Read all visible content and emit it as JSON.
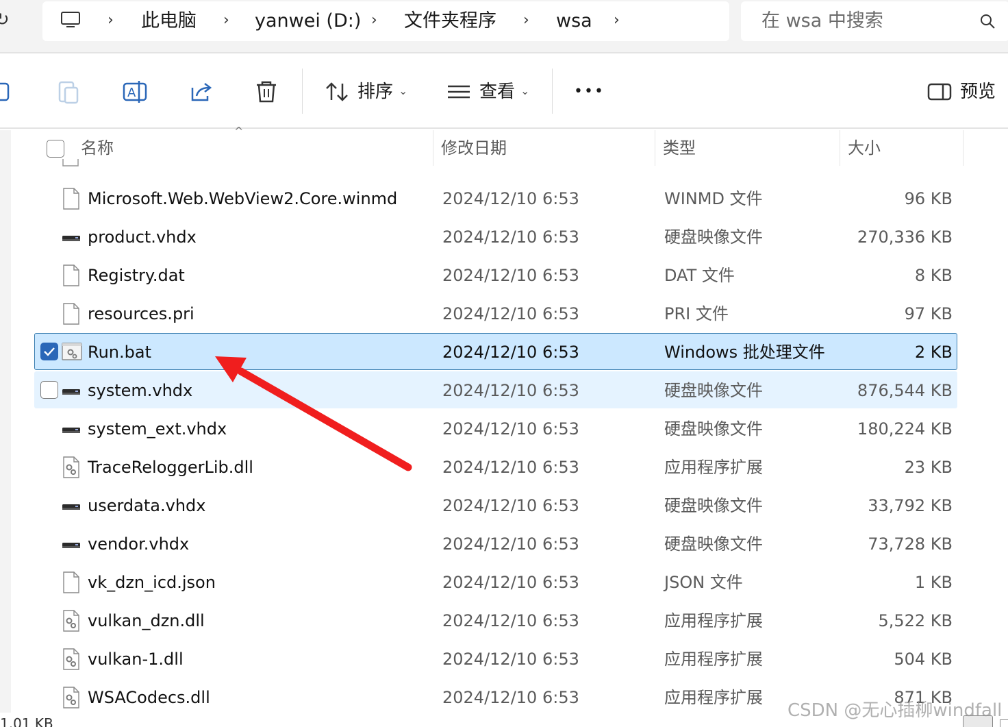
{
  "breadcrumb": {
    "items": [
      "此电脑",
      "yanwei (D:)",
      "文件夹程序",
      "wsa"
    ]
  },
  "search": {
    "placeholder": "在 wsa 中搜索"
  },
  "toolbar": {
    "sort_label": "排序",
    "view_label": "查看",
    "more_label": "•••",
    "preview_label": "预览"
  },
  "columns": {
    "name": "名称",
    "date": "修改日期",
    "type": "类型",
    "size": "大小"
  },
  "files": [
    {
      "name": "Microsoft.Web.WebView2.Core.winmd",
      "date": "2024/12/10 6:53",
      "type": "WINMD 文件",
      "size": "96 KB",
      "icon": "file-icon"
    },
    {
      "name": "product.vhdx",
      "date": "2024/12/10 6:53",
      "type": "硬盘映像文件",
      "size": "270,336 KB",
      "icon": "disk-image-icon"
    },
    {
      "name": "Registry.dat",
      "date": "2024/12/10 6:53",
      "type": "DAT 文件",
      "size": "8 KB",
      "icon": "file-icon"
    },
    {
      "name": "resources.pri",
      "date": "2024/12/10 6:53",
      "type": "PRI 文件",
      "size": "97 KB",
      "icon": "file-icon"
    },
    {
      "name": "Run.bat",
      "date": "2024/12/10 6:53",
      "type": "Windows 批处理文件",
      "size": "2 KB",
      "icon": "batch-file-icon",
      "state": "selected"
    },
    {
      "name": "system.vhdx",
      "date": "2024/12/10 6:53",
      "type": "硬盘映像文件",
      "size": "876,544 KB",
      "icon": "disk-image-icon",
      "state": "hover"
    },
    {
      "name": "system_ext.vhdx",
      "date": "2024/12/10 6:53",
      "type": "硬盘映像文件",
      "size": "180,224 KB",
      "icon": "disk-image-icon"
    },
    {
      "name": "TraceReloggerLib.dll",
      "date": "2024/12/10 6:53",
      "type": "应用程序扩展",
      "size": "23 KB",
      "icon": "dll-file-icon"
    },
    {
      "name": "userdata.vhdx",
      "date": "2024/12/10 6:53",
      "type": "硬盘映像文件",
      "size": "33,792 KB",
      "icon": "disk-image-icon"
    },
    {
      "name": "vendor.vhdx",
      "date": "2024/12/10 6:53",
      "type": "硬盘映像文件",
      "size": "73,728 KB",
      "icon": "disk-image-icon"
    },
    {
      "name": "vk_dzn_icd.json",
      "date": "2024/12/10 6:53",
      "type": "JSON 文件",
      "size": "1 KB",
      "icon": "file-icon"
    },
    {
      "name": "vulkan_dzn.dll",
      "date": "2024/12/10 6:53",
      "type": "应用程序扩展",
      "size": "5,522 KB",
      "icon": "dll-file-icon"
    },
    {
      "name": "vulkan-1.dll",
      "date": "2024/12/10 6:53",
      "type": "应用程序扩展",
      "size": "504 KB",
      "icon": "dll-file-icon"
    },
    {
      "name": "WSACodecs.dll",
      "date": "2024/12/10 6:53",
      "type": "应用程序扩展",
      "size": "871 KB",
      "icon": "dll-file-icon"
    }
  ],
  "status": {
    "text": "1.01 KB"
  },
  "watermark": "CSDN @无心插柳windfall",
  "colors": {
    "selected_bg": "#cce8ff",
    "selected_border": "#3c7fb1",
    "hover_bg": "#e5f3ff",
    "checkbox_blue": "#2a67b8",
    "annotation_arrow": "#f01e1e"
  }
}
